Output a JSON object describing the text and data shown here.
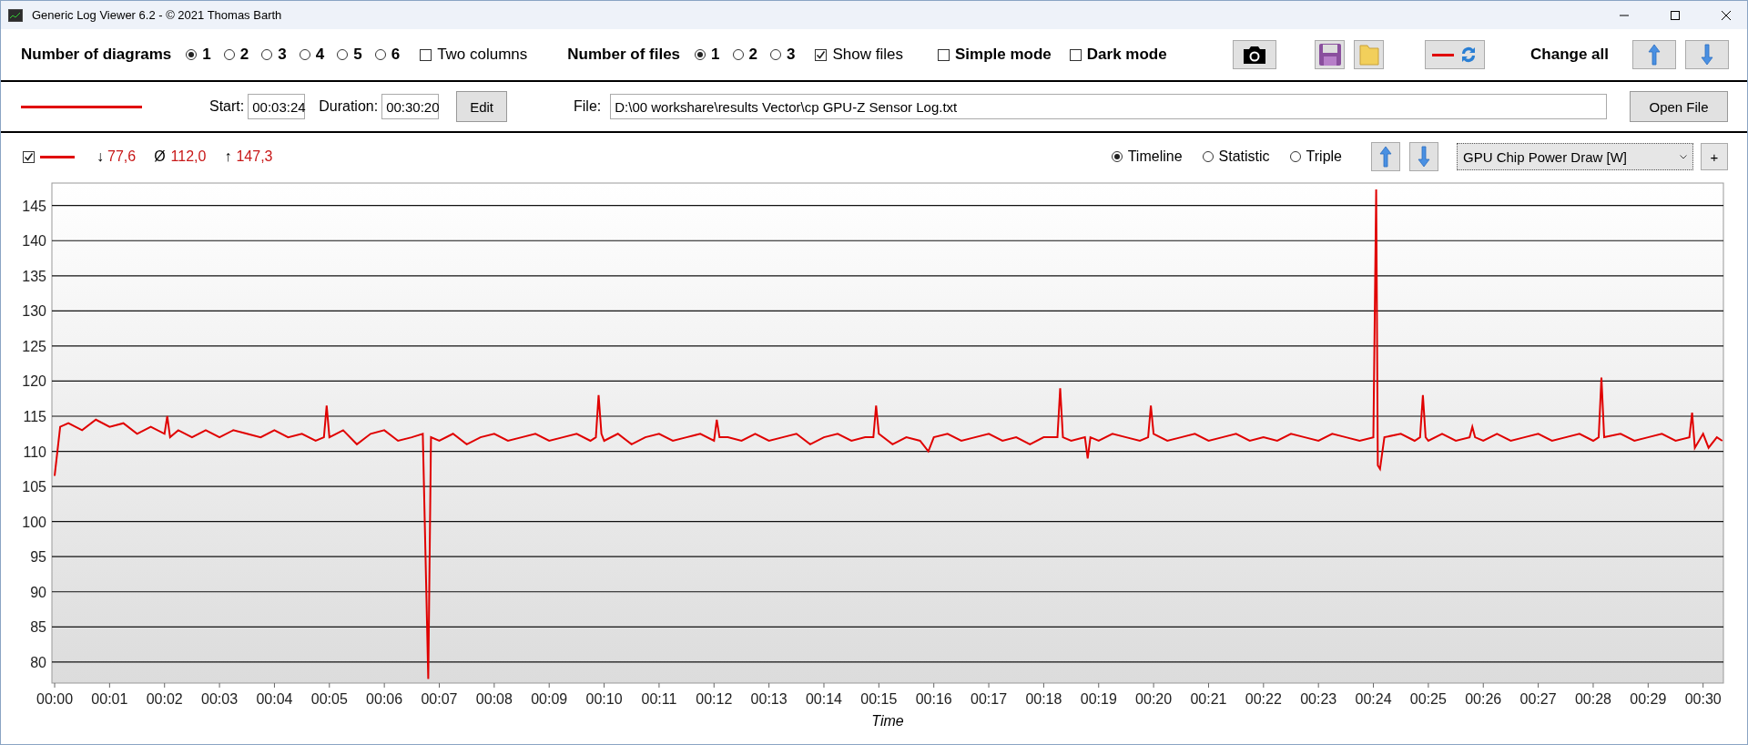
{
  "window": {
    "title": "Generic Log Viewer 6.2 - © 2021 Thomas Barth"
  },
  "toolbar": {
    "diagrams_label": "Number of diagrams",
    "diagram_options": [
      {
        "label": "1",
        "selected": true
      },
      {
        "label": "2",
        "selected": false
      },
      {
        "label": "3",
        "selected": false
      },
      {
        "label": "4",
        "selected": false
      },
      {
        "label": "5",
        "selected": false
      },
      {
        "label": "6",
        "selected": false
      }
    ],
    "two_columns": {
      "label": "Two columns",
      "checked": false
    },
    "files_label": "Number of files",
    "file_options": [
      {
        "label": "1",
        "selected": true
      },
      {
        "label": "2",
        "selected": false
      },
      {
        "label": "3",
        "selected": false
      }
    ],
    "show_files": {
      "label": "Show files",
      "checked": true
    },
    "simple_mode": {
      "label": "Simple mode",
      "checked": false
    },
    "dark_mode": {
      "label": "Dark mode",
      "checked": false
    },
    "change_all_label": "Change all"
  },
  "file_row": {
    "start_label": "Start:",
    "start": "00:03:24",
    "duration_label": "Duration:",
    "duration": "00:30:20",
    "edit_button": "Edit",
    "file_label": "File:",
    "file_path": "D:\\00 workshare\\results Vector\\cp GPU-Z Sensor Log.txt",
    "open_button": "Open File"
  },
  "diagram": {
    "visible": {
      "checked": true
    },
    "min_symbol": "↓",
    "min": "77,6",
    "avg_symbol": "Ø",
    "avg": "112,0",
    "max_symbol": "↑",
    "max": "147,3",
    "views": [
      {
        "label": "Timeline",
        "selected": true
      },
      {
        "label": "Statistic",
        "selected": false
      },
      {
        "label": "Triple",
        "selected": false
      }
    ],
    "channel": "GPU Chip Power Draw [W]",
    "add_button": "+",
    "chart_data": {
      "type": "line",
      "grid": true,
      "xlabel": "Time",
      "xlim": [
        -0.05,
        30.37
      ],
      "ylim": [
        77,
        148.2
      ],
      "xticks": [
        {
          "value": 0,
          "label": "00:00"
        },
        {
          "value": 1,
          "label": "00:01"
        },
        {
          "value": 2,
          "label": "00:02"
        },
        {
          "value": 3,
          "label": "00:03"
        },
        {
          "value": 4,
          "label": "00:04"
        },
        {
          "value": 5,
          "label": "00:05"
        },
        {
          "value": 6,
          "label": "00:06"
        },
        {
          "value": 7,
          "label": "00:07"
        },
        {
          "value": 8,
          "label": "00:08"
        },
        {
          "value": 9,
          "label": "00:09"
        },
        {
          "value": 10,
          "label": "00:10"
        },
        {
          "value": 11,
          "label": "00:11"
        },
        {
          "value": 12,
          "label": "00:12"
        },
        {
          "value": 13,
          "label": "00:13"
        },
        {
          "value": 14,
          "label": "00:14"
        },
        {
          "value": 15,
          "label": "00:15"
        },
        {
          "value": 16,
          "label": "00:16"
        },
        {
          "value": 17,
          "label": "00:17"
        },
        {
          "value": 18,
          "label": "00:18"
        },
        {
          "value": 19,
          "label": "00:19"
        },
        {
          "value": 20,
          "label": "00:20"
        },
        {
          "value": 21,
          "label": "00:21"
        },
        {
          "value": 22,
          "label": "00:22"
        },
        {
          "value": 23,
          "label": "00:23"
        },
        {
          "value": 24,
          "label": "00:24"
        },
        {
          "value": 25,
          "label": "00:25"
        },
        {
          "value": 26,
          "label": "00:26"
        },
        {
          "value": 27,
          "label": "00:27"
        },
        {
          "value": 28,
          "label": "00:28"
        },
        {
          "value": 29,
          "label": "00:29"
        },
        {
          "value": 30,
          "label": "00:30"
        }
      ],
      "yticks": [
        80,
        85,
        90,
        95,
        100,
        105,
        110,
        115,
        120,
        125,
        130,
        135,
        140,
        145
      ],
      "x": [
        0,
        0.1,
        0.25,
        0.5,
        0.75,
        1,
        1.25,
        1.5,
        1.75,
        2,
        2.05,
        2.1,
        2.25,
        2.5,
        2.75,
        3,
        3.25,
        3.5,
        3.75,
        4,
        4.25,
        4.5,
        4.75,
        4.9,
        4.95,
        5,
        5.25,
        5.5,
        5.75,
        6,
        6.25,
        6.5,
        6.7,
        6.8,
        6.85,
        7,
        7.25,
        7.5,
        7.75,
        8,
        8.25,
        8.5,
        8.75,
        9,
        9.25,
        9.5,
        9.75,
        9.85,
        9.9,
        9.95,
        10,
        10.25,
        10.5,
        10.75,
        11,
        11.25,
        11.5,
        11.75,
        12,
        12.05,
        12.1,
        12.25,
        12.5,
        12.75,
        13,
        13.25,
        13.5,
        13.75,
        14,
        14.25,
        14.5,
        14.75,
        14.9,
        14.95,
        15,
        15.25,
        15.5,
        15.75,
        15.9,
        16,
        16.25,
        16.5,
        16.75,
        17,
        17.25,
        17.5,
        17.75,
        18,
        18.25,
        18.3,
        18.35,
        18.5,
        18.75,
        18.8,
        18.85,
        19,
        19.25,
        19.5,
        19.75,
        19.9,
        19.95,
        20,
        20.25,
        20.5,
        20.75,
        21,
        21.25,
        21.5,
        21.75,
        22,
        22.25,
        22.5,
        22.75,
        23,
        23.25,
        23.5,
        23.75,
        24,
        24.05,
        24.08,
        24.12,
        24.2,
        24.5,
        24.75,
        24.85,
        24.9,
        24.95,
        25,
        25.25,
        25.5,
        25.75,
        25.8,
        25.85,
        26,
        26.25,
        26.5,
        26.75,
        27,
        27.25,
        27.5,
        27.75,
        28,
        28.1,
        28.15,
        28.2,
        28.5,
        28.75,
        29,
        29.25,
        29.5,
        29.75,
        29.8,
        29.85,
        30,
        30.1,
        30.25,
        30.35
      ],
      "series": [
        {
          "color": "#e00000",
          "values": [
            106.5,
            113.5,
            114,
            113,
            114.5,
            113.5,
            114,
            112.5,
            113.5,
            112.5,
            115,
            112,
            113,
            112,
            113,
            112,
            113,
            112.5,
            112,
            113,
            112,
            112.5,
            111.5,
            112,
            116.5,
            112,
            113,
            111,
            112.5,
            113,
            111.5,
            112,
            112.5,
            77.6,
            112,
            111.5,
            112.5,
            111,
            112,
            112.5,
            111.5,
            112,
            112.5,
            111.5,
            112,
            112.5,
            111.5,
            112,
            118,
            112.5,
            111.5,
            112.5,
            111,
            112,
            112.5,
            111.5,
            112,
            112.5,
            111.5,
            114.5,
            112,
            112,
            111.5,
            112.5,
            111.5,
            112,
            112.5,
            111,
            112,
            112.5,
            111.5,
            112,
            112,
            116.5,
            112.5,
            111,
            112,
            111.5,
            110,
            112,
            112.5,
            111.5,
            112,
            112.5,
            111.5,
            112,
            111,
            112,
            112,
            119,
            112,
            111.5,
            112,
            109,
            112,
            111.5,
            112.5,
            112,
            111.5,
            112,
            116.5,
            112.5,
            111.5,
            112,
            112.5,
            111.5,
            112,
            112.5,
            111.5,
            112,
            111.5,
            112.5,
            112,
            111.5,
            112.5,
            112,
            111.5,
            112,
            147.3,
            108,
            107.5,
            112,
            112.5,
            111.5,
            112,
            118,
            112,
            111.5,
            112.5,
            111.5,
            112,
            113.5,
            112,
            111.5,
            112.5,
            111.5,
            112,
            112.5,
            111.5,
            112,
            112.5,
            111.5,
            112,
            120.5,
            112,
            112.5,
            111.5,
            112,
            112.5,
            111.5,
            112,
            115.5,
            110.5,
            112.5,
            110.5,
            112,
            111.5
          ]
        }
      ]
    }
  }
}
